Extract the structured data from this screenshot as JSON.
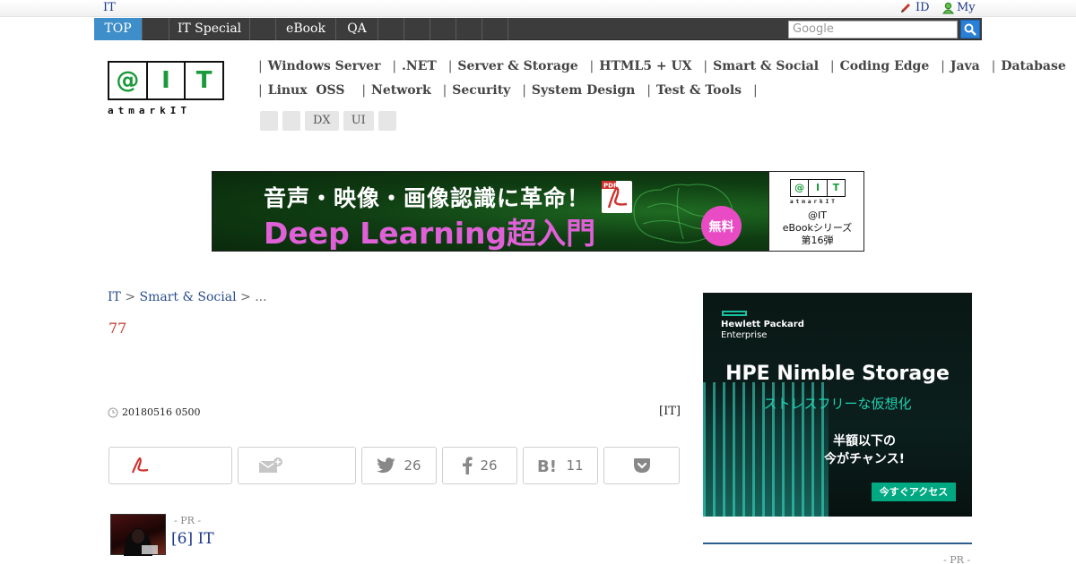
{
  "topbar": {
    "site": "IT",
    "id_label": "ID",
    "my_label": "My"
  },
  "nav": {
    "tabs": [
      "TOP",
      "",
      "IT Special",
      "",
      "eBook",
      "QA",
      "",
      "",
      "",
      ""
    ],
    "search_placeholder": "Google"
  },
  "logo": {
    "letters": [
      "@",
      "I",
      "T"
    ],
    "sub": "atmarkIT"
  },
  "categories": {
    "row1": [
      "Windows Server",
      ".NET",
      "Server & Storage",
      "HTML5 + UX",
      "Smart & Social",
      "Coding Edge",
      "Java",
      "Database"
    ],
    "row2": [
      "Linux  OSS",
      "Network",
      "Security",
      "System Design",
      "Test & Tools"
    ],
    "pills": [
      "",
      "",
      "DX",
      "UI",
      ""
    ]
  },
  "banner": {
    "line1": "音声・映像・画像認識に革命！",
    "line2": "Deep Learning超入門",
    "pdf": "PDF",
    "badge": "無料",
    "mini_letters": [
      "@",
      "I",
      "T"
    ],
    "mini_sub": "atmarkIT",
    "right_text": [
      "@IT",
      "eBookシリーズ",
      "第16弾"
    ]
  },
  "breadcrumb": {
    "root": "IT",
    "section": "Smart & Social",
    "tail": "..."
  },
  "article": {
    "title": "77",
    "date": "20180516 0500",
    "author": "[IT]"
  },
  "share": {
    "twitter_count": "26",
    "facebook_count": "26",
    "hatena_count": "11"
  },
  "pr_item": {
    "label": "- PR -",
    "title": "[6] IT"
  },
  "side_ad": {
    "brand1": "Hewlett Packard",
    "brand2": "Enterprise",
    "headline": "HPE Nimble Storage",
    "subline": "ストレスフリーな仮想化",
    "message1": "半額以下の",
    "message2": "今がチャンス!",
    "cta": "今すぐアクセス",
    "accent": "#01a982"
  },
  "side_pr": "- PR -"
}
